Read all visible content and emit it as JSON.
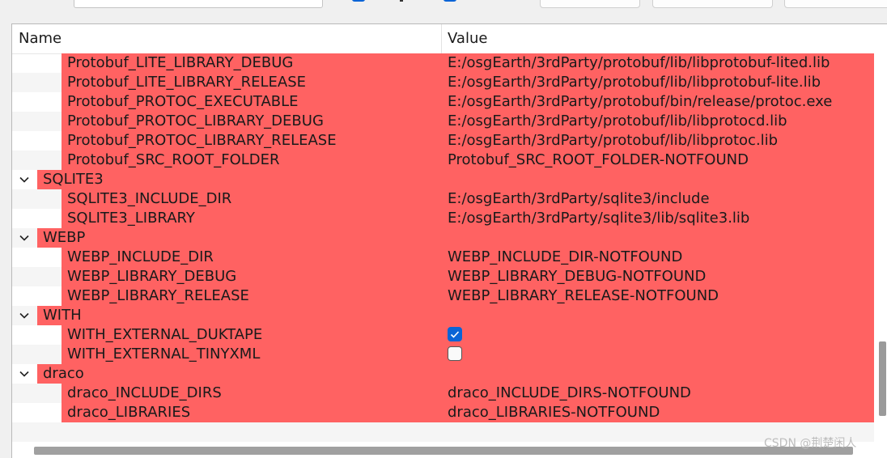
{
  "columns": {
    "name": "Name",
    "value": "Value"
  },
  "rows": [
    {
      "kind": "item",
      "name": "Protobuf_LITE_LIBRARY_DEBUG",
      "value": "E:/osgEarth/3rdParty/protobuf/lib/libprotobuf-lited.lib"
    },
    {
      "kind": "item",
      "name": "Protobuf_LITE_LIBRARY_RELEASE",
      "value": "E:/osgEarth/3rdParty/protobuf/lib/libprotobuf-lite.lib"
    },
    {
      "kind": "item",
      "name": "Protobuf_PROTOC_EXECUTABLE",
      "value": "E:/osgEarth/3rdParty/protobuf/bin/release/protoc.exe"
    },
    {
      "kind": "item",
      "name": "Protobuf_PROTOC_LIBRARY_DEBUG",
      "value": "E:/osgEarth/3rdParty/protobuf/lib/libprotocd.lib"
    },
    {
      "kind": "item",
      "name": "Protobuf_PROTOC_LIBRARY_RELEASE",
      "value": "E:/osgEarth/3rdParty/protobuf/lib/libprotoc.lib"
    },
    {
      "kind": "item",
      "name": "Protobuf_SRC_ROOT_FOLDER",
      "value": "Protobuf_SRC_ROOT_FOLDER-NOTFOUND"
    },
    {
      "kind": "group",
      "name": "SQLITE3"
    },
    {
      "kind": "item",
      "name": "SQLITE3_INCLUDE_DIR",
      "value": "E:/osgEarth/3rdParty/sqlite3/include"
    },
    {
      "kind": "item",
      "name": "SQLITE3_LIBRARY",
      "value": "E:/osgEarth/3rdParty/sqlite3/lib/sqlite3.lib"
    },
    {
      "kind": "group",
      "name": "WEBP"
    },
    {
      "kind": "item",
      "name": "WEBP_INCLUDE_DIR",
      "value": "WEBP_INCLUDE_DIR-NOTFOUND"
    },
    {
      "kind": "item",
      "name": "WEBP_LIBRARY_DEBUG",
      "value": "WEBP_LIBRARY_DEBUG-NOTFOUND"
    },
    {
      "kind": "item",
      "name": "WEBP_LIBRARY_RELEASE",
      "value": "WEBP_LIBRARY_RELEASE-NOTFOUND"
    },
    {
      "kind": "group",
      "name": "WITH"
    },
    {
      "kind": "bool",
      "name": "WITH_EXTERNAL_DUKTAPE",
      "checked": true
    },
    {
      "kind": "bool",
      "name": "WITH_EXTERNAL_TINYXML",
      "checked": false
    },
    {
      "kind": "group",
      "name": "draco"
    },
    {
      "kind": "item",
      "name": "draco_INCLUDE_DIRS",
      "value": "draco_INCLUDE_DIRS-NOTFOUND"
    },
    {
      "kind": "item",
      "name": "draco_LIBRARIES",
      "value": "draco_LIBRARIES-NOTFOUND"
    }
  ],
  "watermark": "CSDN @荆楚闲人",
  "colors": {
    "highlight": "#ff6262",
    "checkbox_on": "#0a64d6",
    "alt_row": "#f5f5f5"
  }
}
